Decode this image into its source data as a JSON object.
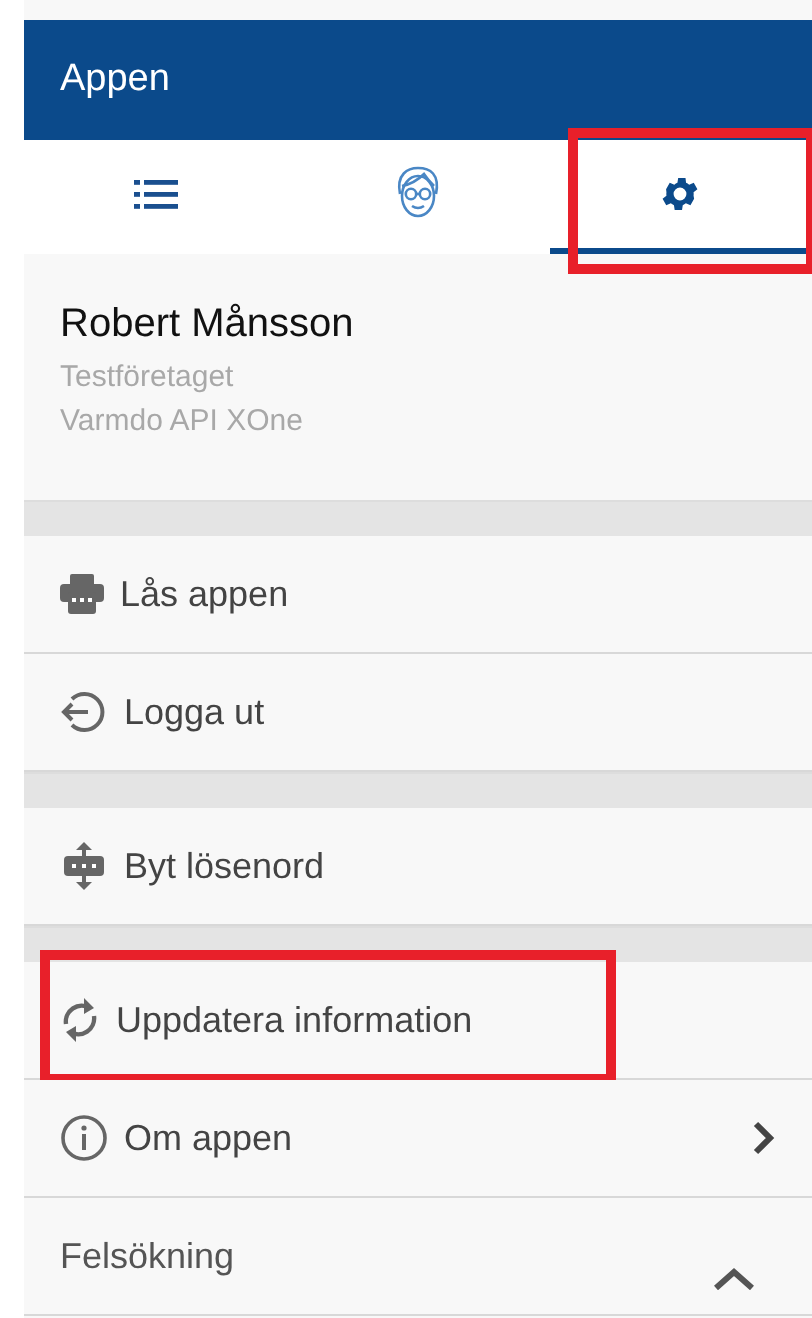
{
  "app_bar": {
    "title": "Appen"
  },
  "tabs": [
    {
      "kind": "list",
      "selected": false,
      "highlighted": false
    },
    {
      "kind": "avatar",
      "selected": false,
      "highlighted": false
    },
    {
      "kind": "settings",
      "selected": true,
      "highlighted": true
    }
  ],
  "profile": {
    "name": "Robert Månsson",
    "company": "Testföretaget",
    "system": "Varmdo API XOne"
  },
  "sections": [
    {
      "items": [
        {
          "kind": "lock",
          "label": "Lås appen",
          "highlighted": false,
          "opens_page": false
        },
        {
          "kind": "logout",
          "label": "Logga ut",
          "highlighted": false,
          "opens_page": false
        }
      ]
    },
    {
      "items": [
        {
          "kind": "password",
          "label": "Byt lösenord",
          "highlighted": false,
          "opens_page": false
        }
      ]
    },
    {
      "items": [
        {
          "kind": "refresh",
          "label": "Uppdatera information",
          "highlighted": true,
          "opens_page": false
        },
        {
          "kind": "info",
          "label": "Om appen",
          "highlighted": false,
          "opens_page": true
        },
        {
          "kind": "plain",
          "label": "Felsökning",
          "highlighted": false,
          "opens_page": false,
          "expanded": true
        }
      ]
    }
  ]
}
